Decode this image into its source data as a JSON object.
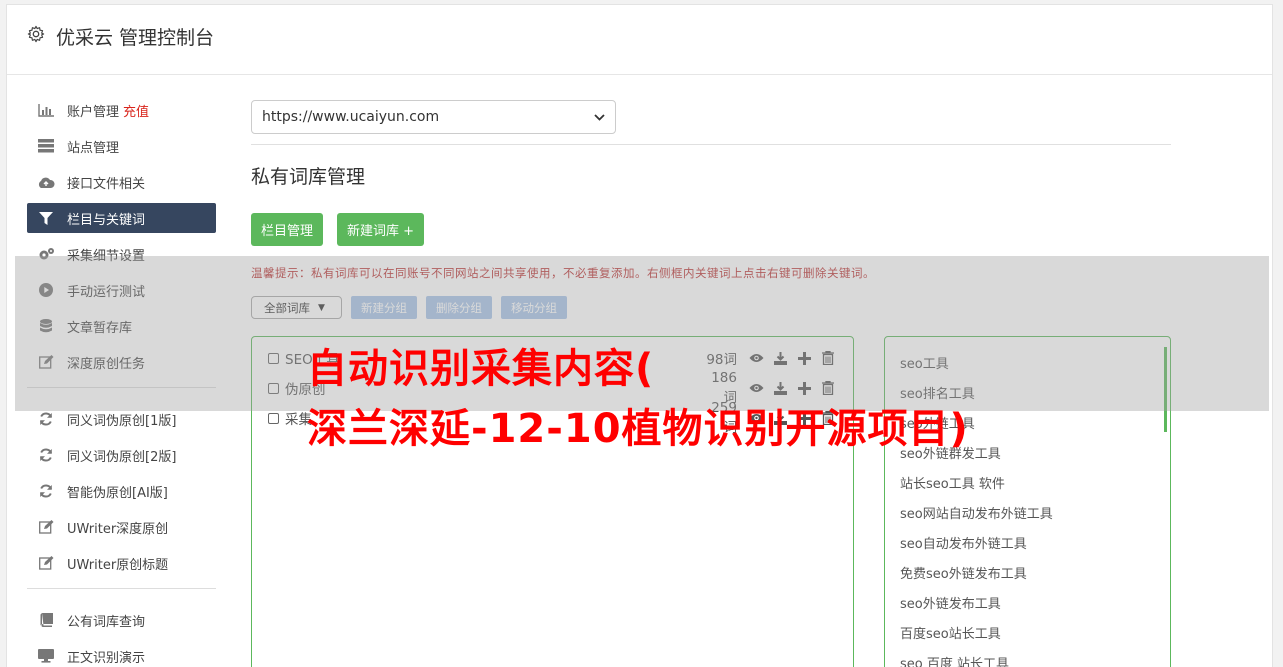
{
  "header": {
    "title": "优采云 管理控制台",
    "icon": "gear-icon"
  },
  "sidebar": {
    "items": [
      {
        "label": "账户管理",
        "badge": "充值",
        "icon": "bar-chart-icon"
      },
      {
        "label": "站点管理",
        "icon": "server-icon"
      },
      {
        "label": "接口文件相关",
        "icon": "cloud-upload-icon"
      },
      {
        "label": "栏目与关键词",
        "icon": "filter-icon",
        "active": true
      },
      {
        "label": "采集细节设置",
        "icon": "cogs-icon"
      },
      {
        "label": "手动运行测试",
        "icon": "play-circle-icon"
      },
      {
        "label": "文章暂存库",
        "icon": "database-icon"
      },
      {
        "label": "深度原创任务",
        "icon": "edit-icon"
      },
      {
        "label": "同义词伪原创[1版]",
        "icon": "refresh-icon"
      },
      {
        "label": "同义词伪原创[2版]",
        "icon": "refresh-icon"
      },
      {
        "label": "智能伪原创[AI版]",
        "icon": "refresh-icon"
      },
      {
        "label": "UWriter深度原创",
        "icon": "edit-icon"
      },
      {
        "label": "UWriter原创标题",
        "icon": "edit-icon"
      },
      {
        "label": "公有词库查询",
        "icon": "book-icon"
      },
      {
        "label": "正文识别演示",
        "icon": "monitor-icon"
      }
    ]
  },
  "main": {
    "site_select": "https://www.ucaiyun.com",
    "section_title": "私有词库管理",
    "buttons": {
      "column_manage": "栏目管理",
      "new_library": "新建词库 +"
    },
    "tip": "温馨提示：私有词库可以在同账号不同网站之间共享使用，不必重复添加。右侧框内关键词上点击右键可删除关键词。",
    "library_select": "全部词库",
    "group_buttons": {
      "new_group": "新建分组",
      "delete_group": "删除分组",
      "move_group": "移动分组"
    },
    "groups": [
      {
        "name": "SEO工具",
        "count": "98词"
      },
      {
        "name": "伪原创",
        "count": "186词"
      },
      {
        "name": "采集",
        "count": "259词"
      }
    ],
    "keywords": [
      "seo工具",
      "seo排名工具",
      "seo外链工具",
      "seo外链群发工具",
      "站长seo工具 软件",
      "seo网站自动发布外链工具",
      "seo自动发布外链工具",
      "免费seo外链发布工具",
      "seo外链发布工具",
      "百度seo站长工具",
      "seo 百度 站长工具"
    ]
  },
  "watermark": {
    "line1": "自动识别采集内容(",
    "line2": "深兰深延-12-10植物识别开源项目)"
  },
  "colors": {
    "accent_green": "#5cb85c",
    "active_nav": "#36465f",
    "watermark_red": "#ff0000",
    "tip_red": "#b33333"
  }
}
